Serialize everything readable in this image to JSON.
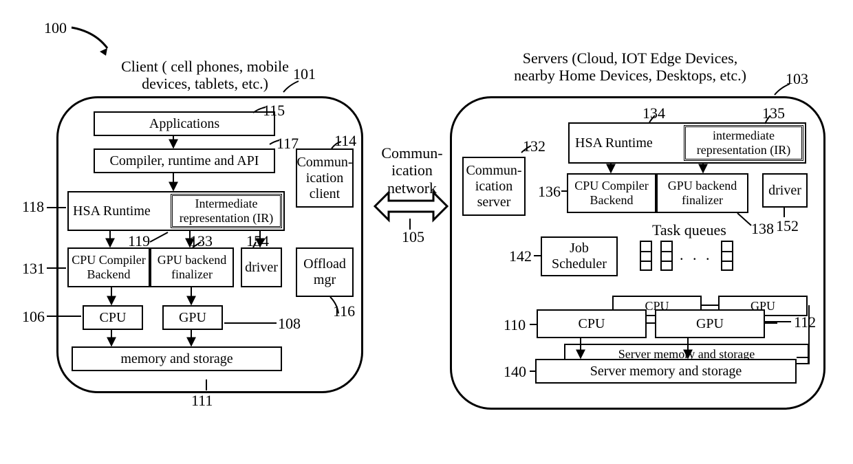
{
  "figure_ref": "100",
  "client": {
    "title": "Client ( cell phones, mobile\ndevices, tablets, etc.)",
    "ref": "101",
    "applications": {
      "label": "Applications",
      "ref": "115"
    },
    "compiler_api": {
      "label": "Compiler, runtime and API",
      "ref": "117"
    },
    "comm_client": {
      "label": "Commun-\nication\nclient",
      "ref": "114"
    },
    "hsa_runtime": {
      "label": "HSA Runtime",
      "ref": "118"
    },
    "ir": {
      "label": "Intermediate\nrepresentation (IR)",
      "ref": "119"
    },
    "cpu_backend": {
      "label": "CPU Compiler\nBackend",
      "ref": "131"
    },
    "gpu_finalizer": {
      "label": "GPU backend\nfinalizer",
      "ref": "133"
    },
    "driver": {
      "label": "driver",
      "ref": "154"
    },
    "offload_mgr": {
      "label": "Offload\nmgr",
      "ref": "116"
    },
    "cpu": {
      "label": "CPU",
      "ref": "106"
    },
    "gpu": {
      "label": "GPU",
      "ref": "108"
    },
    "memory": {
      "label": "memory and storage",
      "ref": "111"
    }
  },
  "network": {
    "label": "Commun-\nication\nnetwork",
    "ref": "105"
  },
  "server": {
    "title": "Servers (Cloud, IOT Edge Devices,\nnearby Home Devices, Desktops, etc.)",
    "ref": "103",
    "comm_server": {
      "label": "Commun-\nication\nserver",
      "ref": "132"
    },
    "hsa_runtime": {
      "label": "HSA Runtime",
      "ref": "134"
    },
    "ir": {
      "label": "intermediate\nrepresentation (IR)",
      "ref": "135"
    },
    "cpu_backend": {
      "label": "CPU Compiler\nBackend",
      "ref": "136"
    },
    "gpu_finalizer": {
      "label": "GPU backend\nfinalizer",
      "ref": "138"
    },
    "driver": {
      "label": "driver",
      "ref": "152"
    },
    "job_sched": {
      "label": "Job\nScheduler",
      "ref": "142"
    },
    "task_queues": {
      "label": "Task queues"
    },
    "cpu": {
      "label": "CPU",
      "ref": "110"
    },
    "cpu_stack": "CPU",
    "gpu": {
      "label": "GPU",
      "ref": "112"
    },
    "gpu_stack": "GPU",
    "memory_back": "Server memory   and storage",
    "memory": {
      "label": "Server memory and storage",
      "ref": "140"
    }
  }
}
